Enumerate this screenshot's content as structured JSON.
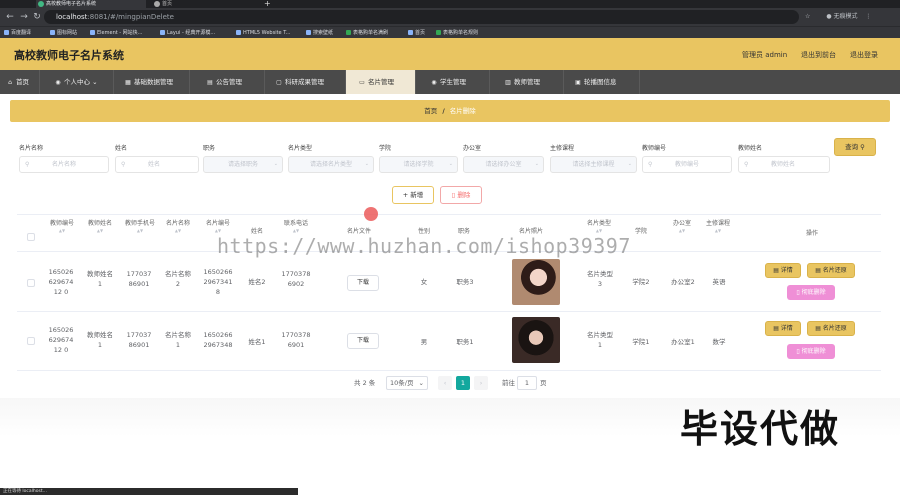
{
  "browser": {
    "tabs": [
      "高校教师电子名片系统",
      "首页"
    ],
    "url_host": "localhost",
    "url_path": ":8081/#/mingpianDelete",
    "profile_label": "无痕模式",
    "bookmarks": [
      "百度翻译",
      "图标网站",
      "Element - 网站快...",
      "Layui - 经典开源模...",
      "HTML5 Website T...",
      "搜索壁纸",
      "表格购单名满刷",
      "首页",
      "表格购单名规则"
    ]
  },
  "header": {
    "title": "高校教师电子名片系统",
    "role_label": "管理员 admin",
    "back_label": "退出到前台",
    "logout_label": "退出登录"
  },
  "menu": [
    {
      "icon": "home-icon",
      "label": "首页"
    },
    {
      "icon": "user-icon",
      "label": "个人中心"
    },
    {
      "icon": "database-icon",
      "label": "基础数据管理"
    },
    {
      "icon": "file-icon",
      "label": "公告管理"
    },
    {
      "icon": "doc-icon",
      "label": "科研成果管理"
    },
    {
      "icon": "card-icon",
      "label": "名片管理"
    },
    {
      "icon": "user-icon",
      "label": "学生管理"
    },
    {
      "icon": "chart-icon",
      "label": "教师管理"
    },
    {
      "icon": "image-icon",
      "label": "轮播图信息"
    }
  ],
  "breadcrumb": {
    "home": "首页",
    "sep": "/",
    "current": "名片删除"
  },
  "filters": {
    "labels": [
      "名片名称",
      "姓名",
      "职务",
      "名片类型",
      "学院",
      "办公室",
      "主修课程",
      "教师编号",
      "教师姓名"
    ],
    "placeholders": [
      "名片名称",
      "姓名",
      "请选择职务",
      "请选择名片类型",
      "请选择学院",
      "请选择办公室",
      "请选择主修课程",
      "教师编号",
      "教师姓名"
    ],
    "query_label": "查询"
  },
  "actions": {
    "add_label": "新增",
    "delete_label": "删除"
  },
  "table": {
    "headers": [
      "教师编号",
      "教师姓名",
      "教师手机号",
      "名片名称",
      "名片编号",
      "姓名",
      "联系电话",
      "名片文件",
      "性别",
      "职务",
      "名片照片",
      "名片类型",
      "学院",
      "办公室",
      "主修课程",
      "操作"
    ],
    "rows": [
      {
        "teacher_no": "16502662967412 0",
        "teacher_name": "教师姓名1",
        "teacher_phone": "17703786901",
        "card_name": "名片名称2",
        "card_no": "16502662967341 8",
        "name": "姓名2",
        "phone": "17703786902",
        "file_btn": "下载",
        "gender": "女",
        "position": "职务3",
        "card_type": "名片类型3",
        "college": "学院2",
        "office": "办公室2",
        "course": "英语"
      },
      {
        "teacher_no": "16502662967412 0",
        "teacher_name": "教师姓名1",
        "teacher_phone": "17703786901",
        "card_name": "名片名称1",
        "card_no": "16502662967348",
        "name": "姓名1",
        "phone": "17703786901",
        "file_btn": "下载",
        "gender": "男",
        "position": "职务1",
        "card_type": "名片类型1",
        "college": "学院1",
        "office": "办公室1",
        "course": "数学"
      }
    ],
    "op_labels": {
      "detail": "详情",
      "restore": "名片还原",
      "purge": "彻底删除"
    }
  },
  "pager": {
    "total": "共 2 条",
    "page_size": "10条/页",
    "current_page": "1",
    "goto_prefix": "前往",
    "goto_value": "1",
    "goto_suffix": "页"
  },
  "watermark": "https://www.huzhan.com/ishop39397",
  "overlay_text": "毕设代做",
  "status_text": "正在等待 localhost..."
}
